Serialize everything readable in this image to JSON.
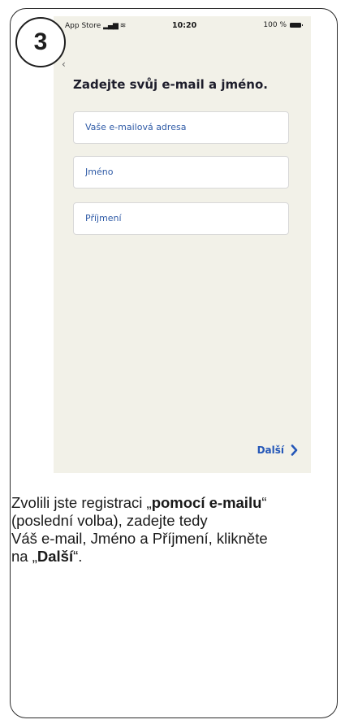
{
  "step": {
    "number": "3"
  },
  "status_bar": {
    "carrier": "App Store",
    "time": "10:20",
    "battery": "100 %"
  },
  "screen": {
    "heading": "Zadejte svůj e-mail a jméno.",
    "fields": {
      "email_placeholder": "Vaše e-mailová adresa",
      "first_name_placeholder": "Jméno",
      "last_name_placeholder": "Příjmení"
    },
    "next_label": "Další"
  },
  "description": {
    "line1_pre": "Zvolili jste registraci „",
    "line1_bold": "pomocí e-mailu",
    "line1_post": "“",
    "line2": "(poslední volba), zadejte tedy",
    "line3": "Váš e-mail, Jméno a Příjmení, klikněte",
    "line4_pre": "na „",
    "line4_bold": "Další",
    "line4_post": "“."
  },
  "colors": {
    "accent": "#2457b8",
    "screen_bg": "#f2f1e8",
    "text_dark": "#1d1d2b"
  }
}
